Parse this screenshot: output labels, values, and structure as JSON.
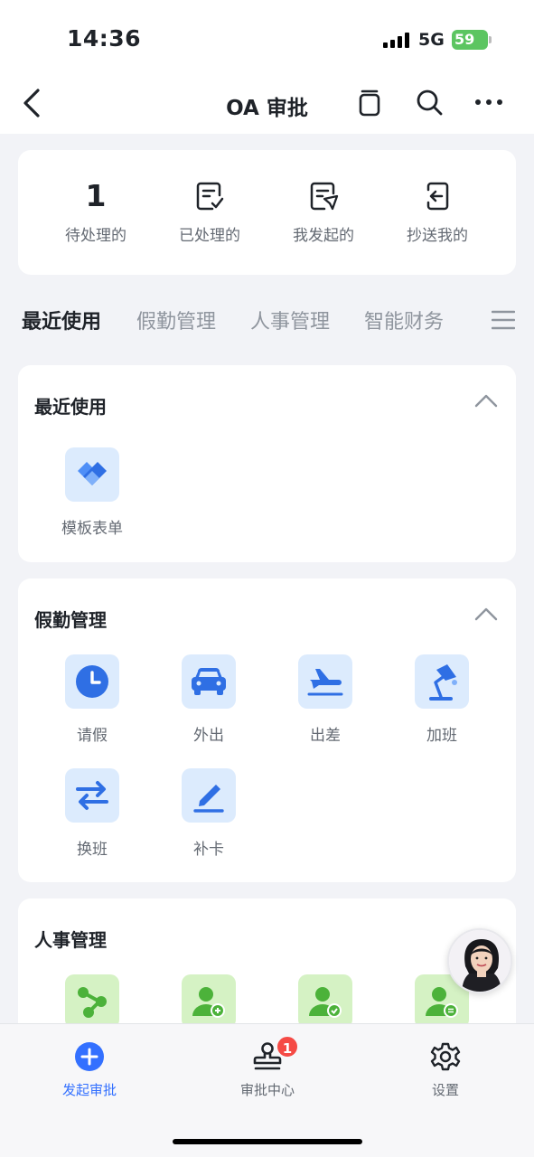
{
  "status": {
    "time": "14:36",
    "network": "5G",
    "battery": "59"
  },
  "nav": {
    "title": "OA 审批",
    "icons": [
      "back-chevron-icon",
      "copy-stack-icon",
      "search-icon",
      "more-icon"
    ]
  },
  "stats": [
    {
      "value": "1",
      "label": "待处理的"
    },
    {
      "icon": "checklist-doc-icon",
      "label": "已处理的"
    },
    {
      "icon": "send-doc-icon",
      "label": "我发起的"
    },
    {
      "icon": "cc-inbox-icon",
      "label": "抄送我的"
    }
  ],
  "tabs": [
    "最近使用",
    "假勤管理",
    "人事管理",
    "智能财务"
  ],
  "sections": {
    "recent": {
      "title": "最近使用",
      "items": [
        {
          "label": "模板表单",
          "icon": "handshake-icon"
        }
      ]
    },
    "attendance": {
      "title": "假勤管理",
      "items": [
        {
          "label": "请假",
          "icon": "clock-icon"
        },
        {
          "label": "外出",
          "icon": "car-icon"
        },
        {
          "label": "出差",
          "icon": "plane-icon"
        },
        {
          "label": "加班",
          "icon": "desk-lamp-icon"
        },
        {
          "label": "换班",
          "icon": "swap-icon"
        },
        {
          "label": "补卡",
          "icon": "pen-icon"
        }
      ]
    },
    "hr": {
      "title": "人事管理",
      "items": [
        {
          "icon": "share-nodes-icon"
        },
        {
          "icon": "user-add-icon"
        },
        {
          "icon": "user-check-icon"
        },
        {
          "icon": "user-transfer-icon"
        }
      ]
    }
  },
  "bottom_nav": [
    {
      "label": "发起审批",
      "icon": "plus-circle-icon",
      "active": true
    },
    {
      "label": "审批中心",
      "icon": "stamp-icon",
      "badge": "1"
    },
    {
      "label": "设置",
      "icon": "gear-icon"
    }
  ],
  "colors": {
    "accent": "#3370ff",
    "tile_blue": "#dcebfd",
    "tile_green": "#d5f2c4",
    "badge": "#f54a45"
  }
}
